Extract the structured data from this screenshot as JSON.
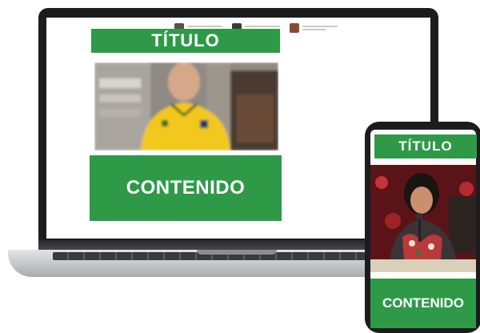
{
  "colors": {
    "accent_green": "#2e9a48",
    "device_frame": "#1c1c1e",
    "screen_background": "#ffffff"
  },
  "laptop": {
    "browser_tabs": [
      {
        "thumb_color": "#5a5044"
      },
      {
        "thumb_color": "#3a3a3a"
      },
      {
        "thumb_color": "#8a4a30"
      }
    ],
    "title": "TÍTULO",
    "photo_icon": "blurred-person-in-yellow-shirt",
    "content": "CONTENIDO"
  },
  "phone": {
    "title": "TÍTULO",
    "photo_icon": "woman-speaking-at-podium",
    "content": "CONTENIDO"
  }
}
